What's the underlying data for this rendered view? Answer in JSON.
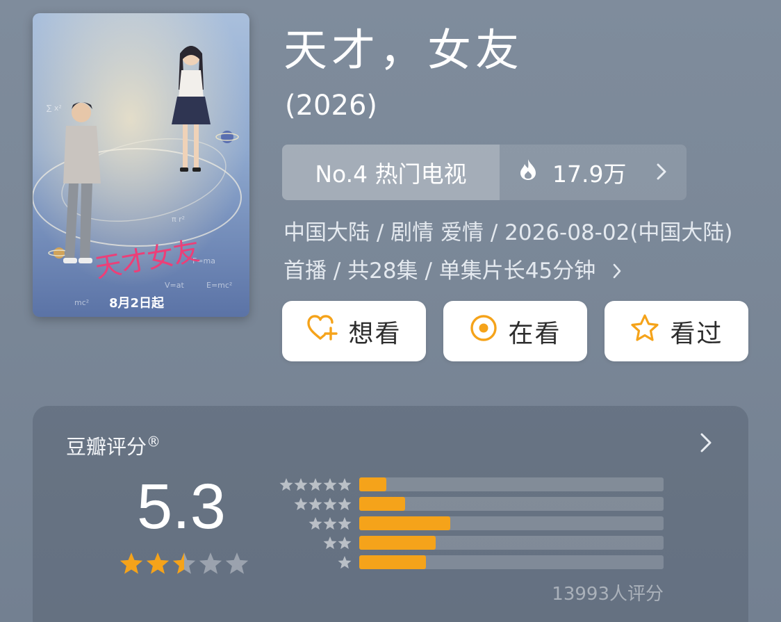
{
  "poster": {
    "date_text": "8月2日起",
    "title_art": "天才女友"
  },
  "header": {
    "title": "天才，女友",
    "year": "(2026)"
  },
  "rank": {
    "label": "No.4 热门电视",
    "heat": "17.9万",
    "icon": "flame-icon"
  },
  "meta": {
    "text": "中国大陆 / 剧情 爱情 / 2026-08-02(中国大陆)首播 / 共28集 / 单集片长45分钟"
  },
  "actions": [
    {
      "label": "想看",
      "icon": "heart-plus-icon"
    },
    {
      "label": "在看",
      "icon": "target-icon"
    },
    {
      "label": "看过",
      "icon": "star-icon"
    }
  ],
  "rating": {
    "title": "豆瓣评分",
    "registered_mark": "®",
    "score": "5.3",
    "stars": 2.5,
    "votes": "13993人评分",
    "distribution_fraction": [
      0.09,
      0.15,
      0.3,
      0.25,
      0.22
    ]
  },
  "colors": {
    "accent_orange": "#f5a31a",
    "background": "#7d8a9a",
    "button_bg": "#ffffff"
  }
}
